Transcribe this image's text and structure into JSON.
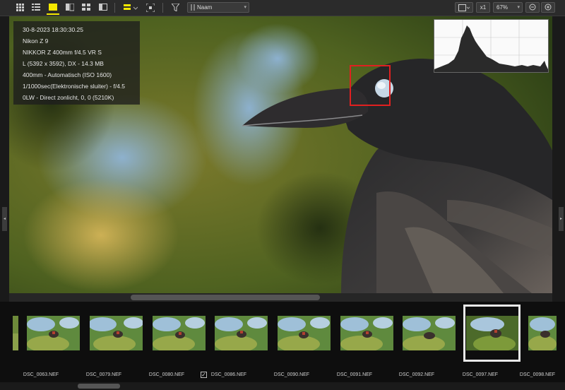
{
  "toolbar": {
    "icons": [
      "grid-view-icon",
      "list-view-icon",
      "single-view-icon",
      "compare-view-icon",
      "quad-view-icon",
      "split-view-icon",
      "adjust-icon",
      "fit-screen-icon",
      "filter-icon",
      "sort-icon",
      "fit-window-icon",
      "zoom-out-icon",
      "zoom-in-icon"
    ],
    "sort_label": "Naam",
    "zoom_1x_label": "x1",
    "zoom_percent": "67%",
    "active_color": "#f5e800"
  },
  "info": {
    "datetime": "30-8-2023 18:30:30.25",
    "camera": "Nikon Z 9",
    "lens": "NIKKOR Z 400mm f/4.5 VR S",
    "size": "L (5392 x 3592), DX - 14.3 MB",
    "focal": "400mm - Automatisch (ISO 1600)",
    "exposure": "1/1000sec(Elektronische sluiter) - f/4.5",
    "white_balance": "0LW - Direct zonlicht, 0, 0 (5210K)"
  },
  "focus_point_color": "#e02020",
  "filmstrip": {
    "files": [
      "DSC_0063.NEF",
      "DSC_0079.NEF",
      "DSC_0080.NEF",
      "DSC_0086.NEF",
      "DSC_0090.NEF",
      "DSC_0091.NEF",
      "DSC_0092.NEF",
      "DSC_0097.NEF",
      "DSC_0098.NEF"
    ],
    "checked_file": "DSC_0086.NEF",
    "selected_file": "DSC_0097.NEF"
  }
}
